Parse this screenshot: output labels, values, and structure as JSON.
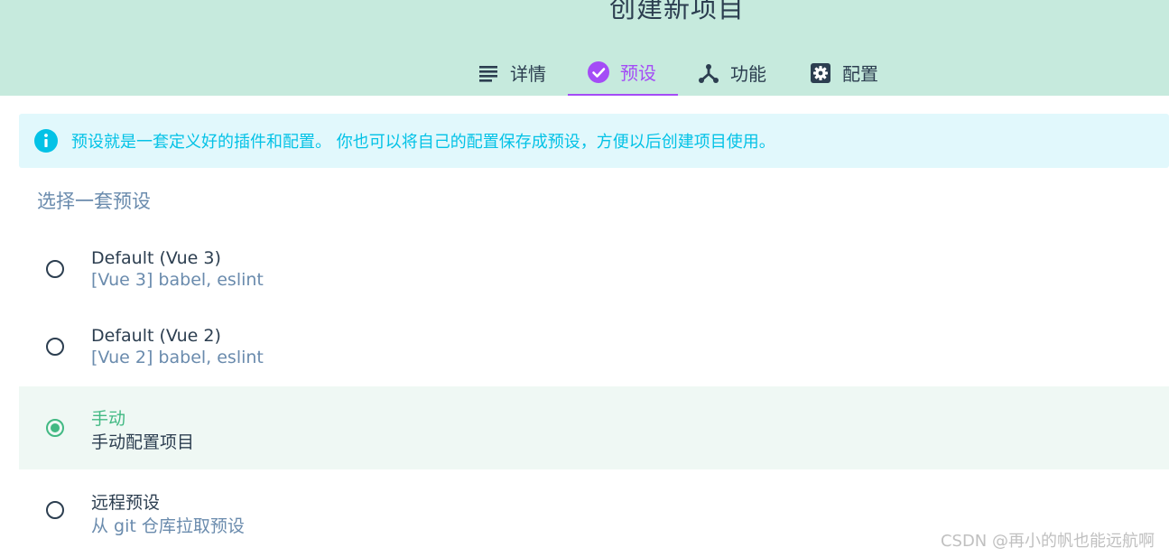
{
  "header": {
    "title": "创建新项目",
    "tabs": [
      {
        "label": "详情",
        "icon": "list-icon"
      },
      {
        "label": "预设",
        "icon": "check-circle-icon",
        "active": true
      },
      {
        "label": "功能",
        "icon": "fork-icon"
      },
      {
        "label": "配置",
        "icon": "gear-icon"
      }
    ]
  },
  "info": {
    "icon": "info-icon",
    "text": "预设就是一套定义好的插件和配置。 你也可以将自己的配置保存成预设，方便以后创建项目使用。"
  },
  "presets": {
    "section_title": "选择一套预设",
    "options": [
      {
        "name": "Default (Vue 3)",
        "description": "[Vue 3] babel, eslint",
        "selected": false
      },
      {
        "name": "Default (Vue 2)",
        "description": "[Vue 2] babel, eslint",
        "selected": false
      },
      {
        "name": "手动",
        "description": "手动配置项目",
        "selected": true
      },
      {
        "name": "远程预设",
        "description": "从 git 仓库拉取预设",
        "selected": false
      }
    ]
  },
  "watermark": "CSDN @再小的帆也能远航啊",
  "colors": {
    "header_bg": "#c6eadd",
    "accent_purple": "#a44cf6",
    "accent_green": "#42b983",
    "info_bg": "#e1f8fc",
    "info_text": "#03c2e6",
    "text_dark": "#2c3e50",
    "text_muted": "#6a8bad"
  }
}
